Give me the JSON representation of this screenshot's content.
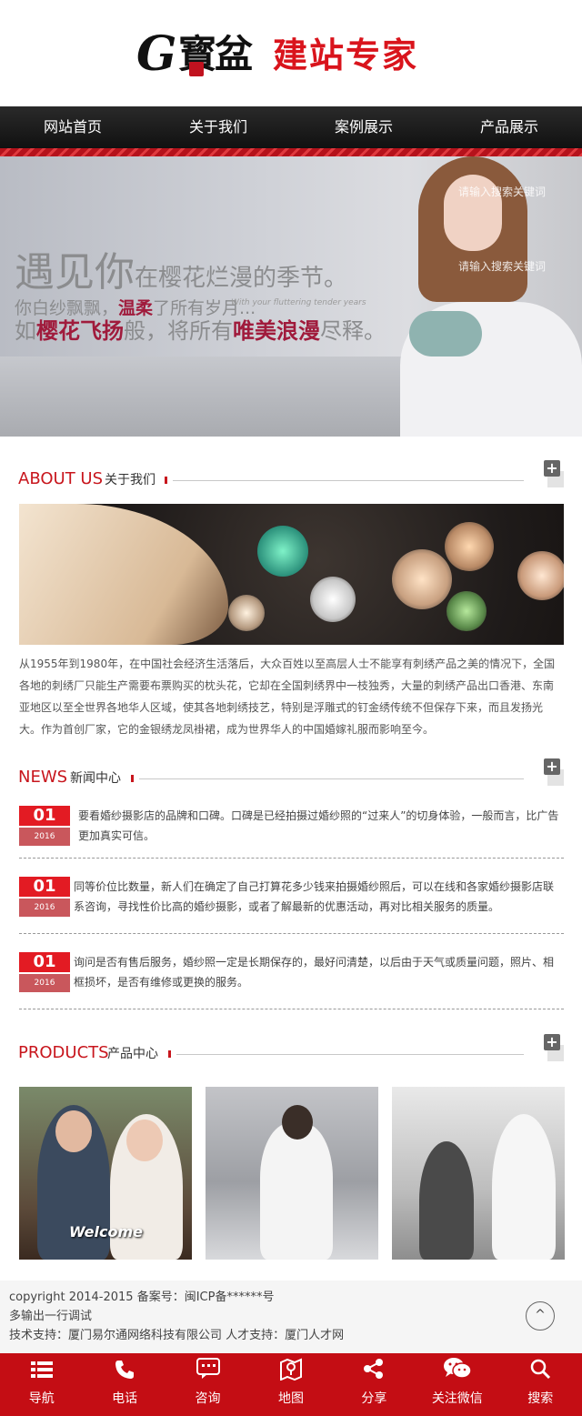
{
  "brand": {
    "logo_letter": "G",
    "logo_cn": "寳盆",
    "slogan": "建站专家"
  },
  "nav": [
    "网站首页",
    "关于我们",
    "案例展示",
    "产品展示"
  ],
  "banner": {
    "search_1": "请输入搜索关键词",
    "search_2": "请输入搜索关键词",
    "line1_big": "遇见你",
    "line1_small": "在樱花烂漫的季节。",
    "line2_a": "你白纱飘飘，",
    "line2_b": "温柔",
    "line2_c": "了所有岁月...",
    "script": "With your fluttering tender years",
    "line3_a": "如",
    "line3_b": "樱花飞扬",
    "line3_c": "般，将所有",
    "line3_d": "唯美浪漫",
    "line3_e": "尽释。"
  },
  "about": {
    "title_en": "ABOUT US",
    "title_cn": "关于我们",
    "more": "+",
    "text": "从1955年到1980年，在中国社会经济生活落后，大众百姓以至高层人士不能享有刺绣产品之美的情况下，全国各地的刺绣厂只能生产需要布票购买的枕头花，它却在全国刺绣界中一枝独秀，大量的刺绣产品出口香港、东南亚地区以至全世界各地华人区域，使其各地刺绣技艺，特别是浮雕式的钉金绣传统不但保存下来，而且发扬光大。作为首创厂家，它的金银绣龙凤褂裙，成为世界华人的中国婚嫁礼服而影响至今。"
  },
  "news": {
    "title_en": "NEWS",
    "title_cn": "新闻中心",
    "more": "+",
    "items": [
      {
        "day": "01",
        "year": "2016",
        "text": "要看婚纱摄影店的品牌和口碑。口碑是已经拍摄过婚纱照的“过来人”的切身体验，一般而言，比广告更加真实可信。"
      },
      {
        "day": "01",
        "year": "2016",
        "text": "同等价位比数量，新人们在确定了自己打算花多少钱来拍摄婚纱照后，可以在线和各家婚纱摄影店联系咨询，寻找性价比高的婚纱摄影，或者了解最新的优惠活动，再对比相关服务的质量。"
      },
      {
        "day": "01",
        "year": "2016",
        "text": "询问是否有售后服务，婚纱照一定是长期保存的，最好问清楚，以后由于天气或质量问题，照片、相框损坏，是否有维修或更换的服务。"
      }
    ]
  },
  "products": {
    "title_en": "PRODUCTS",
    "title_cn": "产品中心",
    "more": "+",
    "welcome_sign": "Welcome"
  },
  "footer": {
    "copyright": "copyright 2014-2015 备案号：闽ICP备******号",
    "line2": "多输出一行调试",
    "line3": "技术支持：厦门易尔通网络科技有限公司 人才支持：厦门人才网",
    "to_top": "^"
  },
  "bottombar": [
    {
      "icon": "menu-icon",
      "label": "导航"
    },
    {
      "icon": "phone-icon",
      "label": "电话"
    },
    {
      "icon": "chat-icon",
      "label": "咨询"
    },
    {
      "icon": "map-icon",
      "label": "地图"
    },
    {
      "icon": "share-icon",
      "label": "分享"
    },
    {
      "icon": "wechat-icon",
      "label": "关注微信"
    },
    {
      "icon": "search-icon",
      "label": "搜索"
    }
  ],
  "colors": {
    "brand_red": "#c8161d",
    "bar_red": "#c40d14",
    "nav_dark": "#1a1a1a"
  }
}
